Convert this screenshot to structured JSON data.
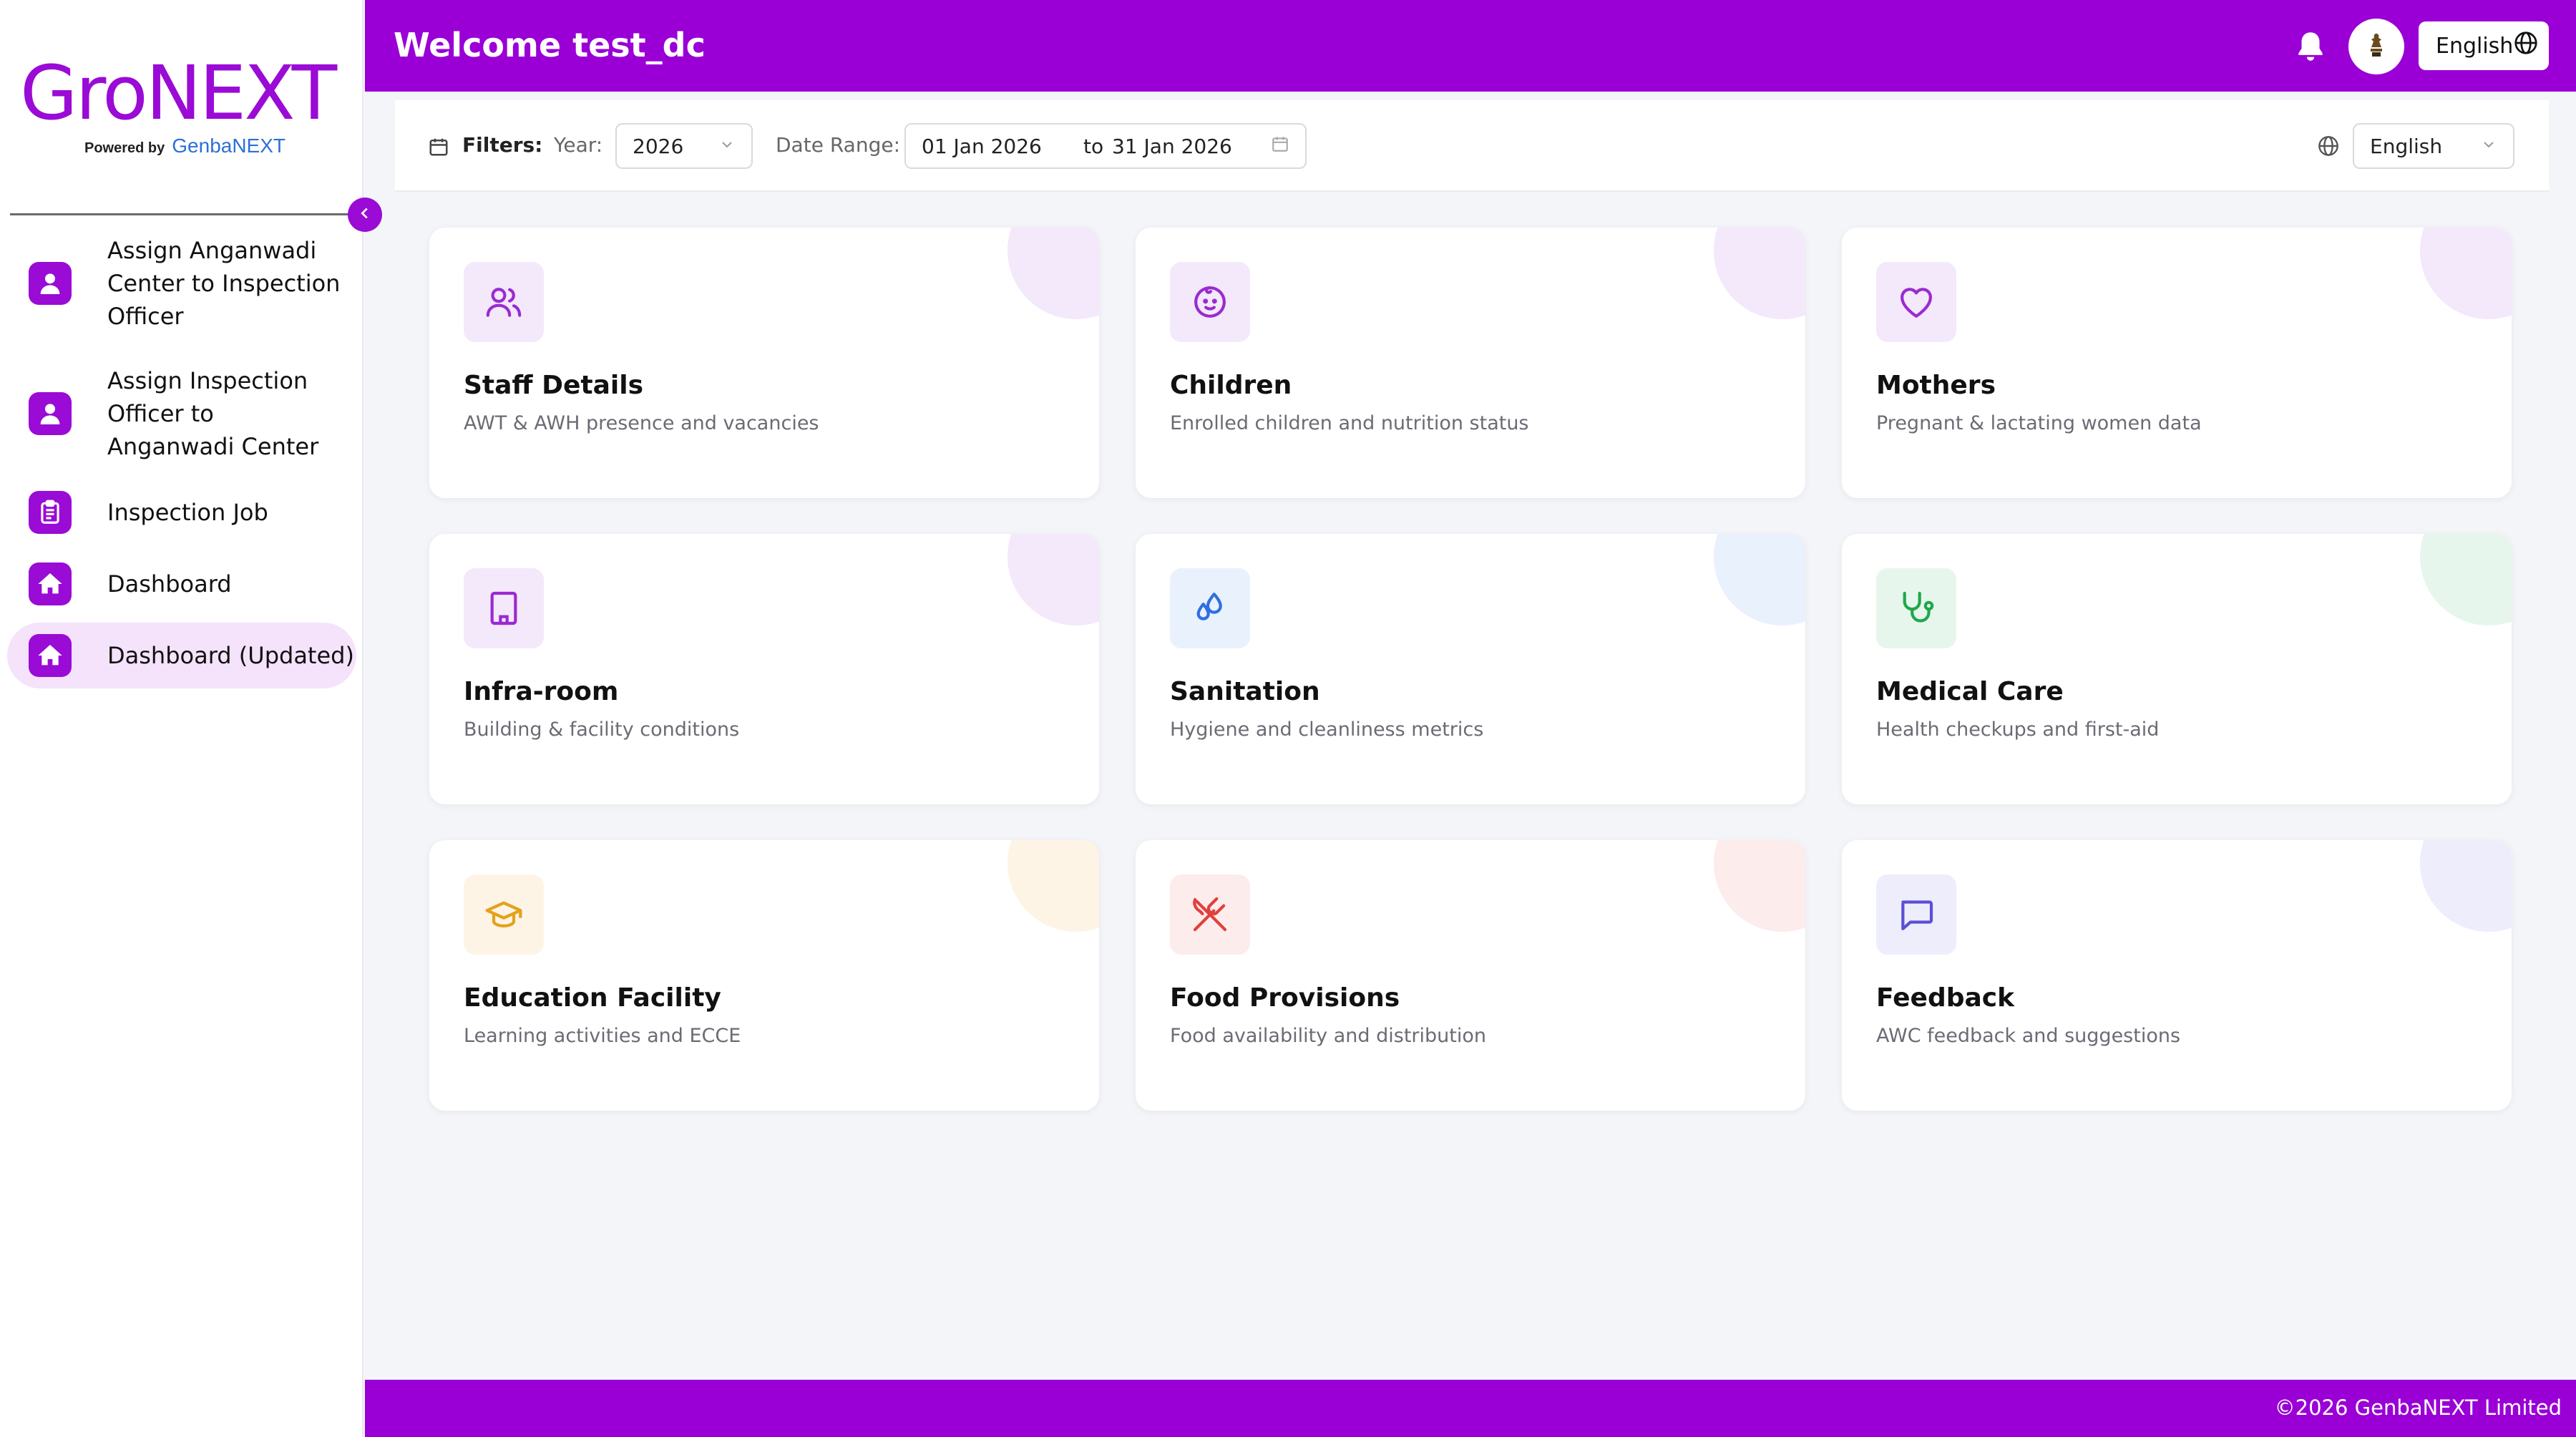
{
  "brand": {
    "logo": "GroNEXT",
    "powered_by": "Powered by",
    "powered_brand": "GenbaNEXT"
  },
  "sidebar": {
    "items": [
      {
        "label": "Assign Anganwadi Center to Inspection Officer",
        "icon": "user-icon",
        "active": false
      },
      {
        "label": "Assign Inspection Officer to Anganwadi Center",
        "icon": "user-icon",
        "active": false
      },
      {
        "label": "Inspection Job",
        "icon": "clipboard-icon",
        "active": false
      },
      {
        "label": "Dashboard",
        "icon": "home-icon",
        "active": false
      },
      {
        "label": "Dashboard (Updated)",
        "icon": "home-icon",
        "active": true
      }
    ]
  },
  "header": {
    "welcome": "Welcome test_dc",
    "language": "English"
  },
  "filters": {
    "label": "Filters:",
    "year_label": "Year:",
    "year_value": "2026",
    "range_label": "Date Range:",
    "range_start": "01 Jan 2026",
    "range_to": "to",
    "range_end": "31 Jan 2026",
    "language": "English"
  },
  "cards": [
    {
      "title": "Staff Details",
      "subtitle": "AWT & AWH presence and vacancies",
      "icon": "users-icon",
      "color": "#9a2bd0",
      "tint": "#f4e8fb"
    },
    {
      "title": "Children",
      "subtitle": "Enrolled children and nutrition status",
      "icon": "baby-icon",
      "color": "#9a2bd0",
      "tint": "#f4e8fb"
    },
    {
      "title": "Mothers",
      "subtitle": "Pregnant & lactating women data",
      "icon": "heart-icon",
      "color": "#9a2bd0",
      "tint": "#f4e8fb"
    },
    {
      "title": "Infra-room",
      "subtitle": "Building & facility conditions",
      "icon": "building-icon",
      "color": "#9a2bd0",
      "tint": "#f4e8fb"
    },
    {
      "title": "Sanitation",
      "subtitle": "Hygiene and cleanliness metrics",
      "icon": "droplets-icon",
      "color": "#2f6fe0",
      "tint": "#e9f1fd"
    },
    {
      "title": "Medical Care",
      "subtitle": "Health checkups and first-aid",
      "icon": "stethoscope-icon",
      "color": "#1ea84a",
      "tint": "#e7f6ec"
    },
    {
      "title": "Education Facility",
      "subtitle": "Learning activities and ECCE",
      "icon": "graduation-cap-icon",
      "color": "#e3a21a",
      "tint": "#fdf4e6"
    },
    {
      "title": "Food Provisions",
      "subtitle": "Food availability and distribution",
      "icon": "utensils-crossed-icon",
      "color": "#e0403c",
      "tint": "#fdecec"
    },
    {
      "title": "Feedback",
      "subtitle": "AWC feedback and suggestions",
      "icon": "message-square-icon",
      "color": "#5b4fd6",
      "tint": "#eeedfb"
    }
  ],
  "footer": {
    "copyright": "©2026 GenbaNEXT Limited"
  }
}
